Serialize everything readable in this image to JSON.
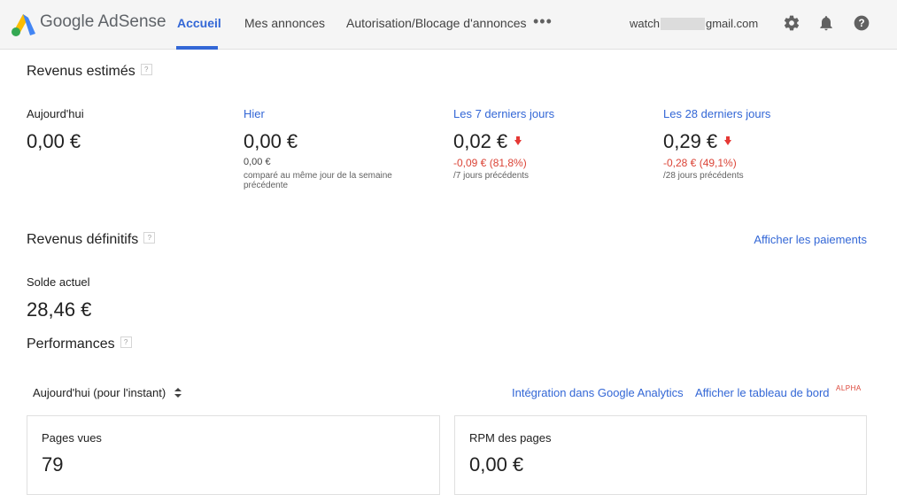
{
  "header": {
    "brand": "Google AdSense",
    "tabs": [
      {
        "label": "Accueil",
        "active": true
      },
      {
        "label": "Mes annonces"
      },
      {
        "label": "Autorisation/Blocage d'annonces"
      }
    ],
    "more": "•••",
    "account_prefix": "watch",
    "account_suffix": "gmail.com"
  },
  "estimated": {
    "title": "Revenus estimés",
    "help": "?",
    "today": {
      "label": "Aujourd'hui",
      "value": "0,00 €"
    },
    "yesterday": {
      "label": "Hier",
      "value": "0,00 €",
      "compare_value": "0,00 €",
      "compare_note": "comparé au même jour de la semaine précédente"
    },
    "last7": {
      "label": "Les 7 derniers jours",
      "value": "0,02 €",
      "change": "-0,09 € (81,8%)",
      "note": "/7 jours précédents"
    },
    "last28": {
      "label": "Les 28 derniers jours",
      "value": "0,29 €",
      "change": "-0,28 € (49,1%)",
      "note": "/28 jours précédents"
    }
  },
  "final": {
    "title": "Revenus définitifs",
    "help": "?",
    "payments_link": "Afficher les paiements",
    "balance_label": "Solde actuel",
    "balance_value": "28,46 €"
  },
  "performance": {
    "title": "Performances",
    "help": "?",
    "period": "Aujourd'hui (pour l'instant)",
    "analytics_link": "Intégration dans Google Analytics",
    "dashboard_link": "Afficher le tableau de bord",
    "alpha": "ALPHA",
    "cards": [
      {
        "label": "Pages vues",
        "value": "79"
      },
      {
        "label": "RPM des pages",
        "value": "0,00 €"
      }
    ]
  },
  "colors": {
    "accent": "#3367d6",
    "negative": "#db4437",
    "header_bg": "#f5f5f5"
  }
}
